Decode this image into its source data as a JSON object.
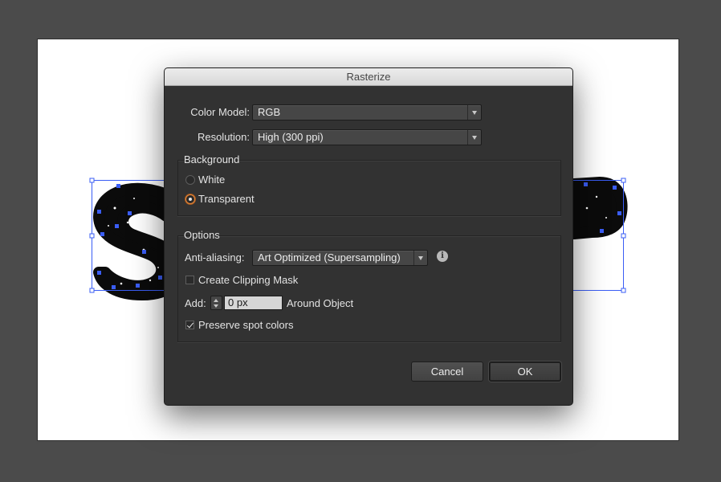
{
  "dialog": {
    "title": "Rasterize",
    "color_model": {
      "label": "Color Model:",
      "value": "RGB"
    },
    "resolution": {
      "label": "Resolution:",
      "value": "High (300 ppi)"
    },
    "background": {
      "title": "Background",
      "options": [
        {
          "label": "White",
          "selected": false
        },
        {
          "label": "Transparent",
          "selected": true
        }
      ]
    },
    "options": {
      "title": "Options",
      "anti_aliasing": {
        "label": "Anti-aliasing:",
        "value": "Art Optimized (Supersampling)"
      },
      "create_clipping_mask": {
        "label": "Create Clipping Mask",
        "checked": false
      },
      "add": {
        "label": "Add:",
        "value": "0 px",
        "suffix": "Around Object"
      },
      "preserve_spot_colors": {
        "label": "Preserve spot colors",
        "checked": true
      }
    },
    "buttons": {
      "cancel": "Cancel",
      "ok": "OK"
    }
  },
  "colors": {
    "canvas_bg": "#4b4b4b",
    "dialog_bg": "#323232",
    "selection_blue": "#3a5df5",
    "radio_accent": "#e8873a"
  }
}
